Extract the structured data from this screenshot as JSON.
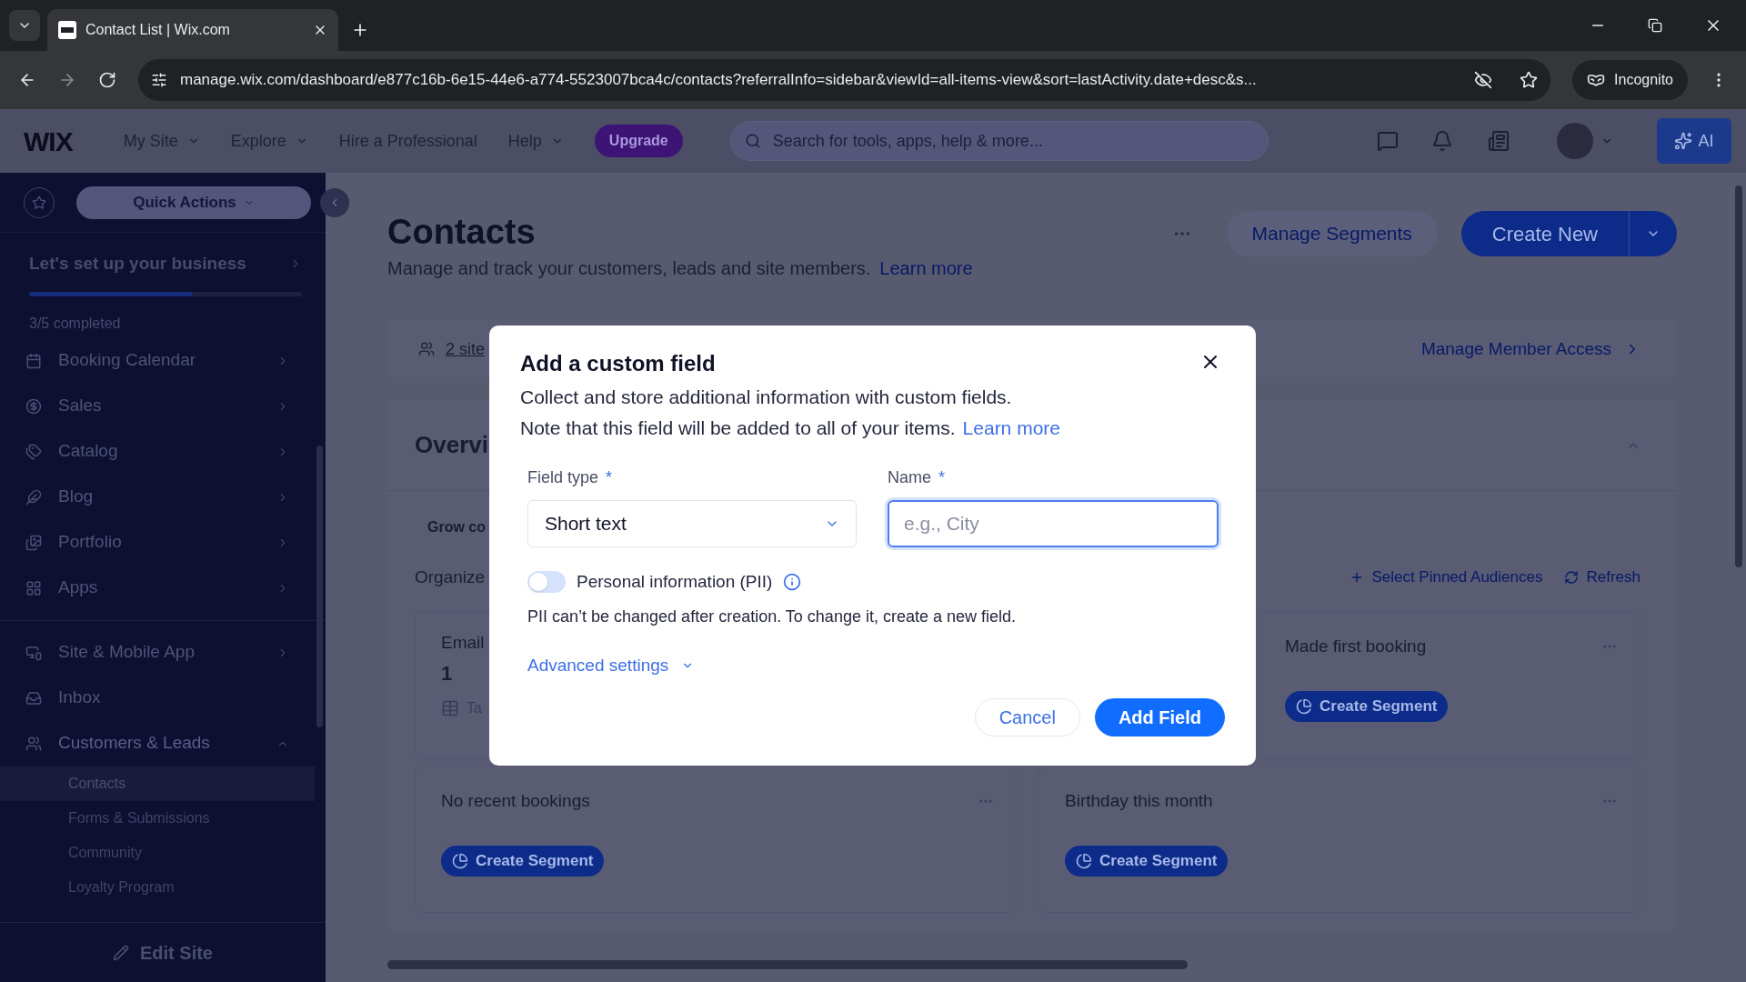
{
  "browser": {
    "tab_title": "Contact List | Wix.com",
    "url": "manage.wix.com/dashboard/e877c16b-6e15-44e6-a774-5523007bca4c/contacts?referralInfo=sidebar&viewId=all-items-view&sort=lastActivity.date+desc&s...",
    "incognito": "Incognito"
  },
  "wix_header": {
    "logo": "WIX",
    "nav": [
      {
        "label": "My Site",
        "kind": "menu"
      },
      {
        "label": "Explore",
        "kind": "menu"
      },
      {
        "label": "Hire a Professional",
        "kind": "link"
      },
      {
        "label": "Help",
        "kind": "menu"
      }
    ],
    "upgrade": "Upgrade",
    "search": {
      "placeholder": "Search for tools, apps, help & more..."
    },
    "ai": "AI"
  },
  "sidebar": {
    "quick_actions": "Quick Actions",
    "setup": {
      "title": "Let's set up your business",
      "level": 0.6,
      "progress": "3/5 completed"
    },
    "sections": [
      {
        "items": [
          {
            "label": "Booking Calendar",
            "kind": "group",
            "expanded": false
          },
          {
            "label": "Sales",
            "kind": "group",
            "expanded": false
          },
          {
            "label": "Catalog",
            "kind": "group",
            "expanded": false
          },
          {
            "label": "Blog",
            "kind": "group",
            "expanded": false
          },
          {
            "label": "Portfolio",
            "kind": "group",
            "expanded": false
          },
          {
            "label": "Apps",
            "kind": "group",
            "expanded": false
          }
        ]
      },
      {
        "items": [
          {
            "label": "Site & Mobile App",
            "kind": "group",
            "expanded": false
          },
          {
            "label": "Inbox",
            "kind": "link",
            "expanded": false
          },
          {
            "label": "Customers & Leads",
            "kind": "group",
            "expanded": true,
            "children": [
              {
                "label": "Contacts",
                "selected": true
              },
              {
                "label": "Forms & Submissions",
                "selected": false
              },
              {
                "label": "Community",
                "selected": false
              },
              {
                "label": "Loyalty Program",
                "selected": false
              }
            ]
          }
        ]
      }
    ],
    "edit_site": "Edit Site"
  },
  "page": {
    "title": "Contacts",
    "subtitle": "Manage and track your customers, leads and site members.",
    "subtitle_link": "Learn more",
    "manage_segments": "Manage Segments",
    "create_new": "Create New",
    "members_bar": {
      "link": "2 site",
      "manage_access": "Manage Member Access"
    },
    "overview": {
      "title": "Overvi",
      "tab": "Grow co",
      "description": "Organize",
      "actions": [
        "Select Pinned Audiences",
        "Refresh"
      ],
      "cards": [
        {
          "kind": "stat",
          "title": "Email",
          "value": "1",
          "footer": "Ta"
        },
        {
          "kind": "segment",
          "title": "Made first booking",
          "button": "Create Segment"
        },
        {
          "kind": "segment",
          "title": "No recent bookings",
          "button": "Create Segment"
        },
        {
          "kind": "segment",
          "title": "Birthday this month",
          "button": "Create Segment"
        }
      ]
    }
  },
  "modal": {
    "title": "Add a custom field",
    "lines": [
      "Collect and store additional information with custom fields.",
      "Note that this field will be added to all of your items."
    ],
    "link": "Learn more",
    "field_type": {
      "label": "Field type",
      "required_mark": "*",
      "value": "Short text"
    },
    "name": {
      "label": "Name",
      "required_mark": "*",
      "placeholder": "e.g., City"
    },
    "pii": {
      "label": "Personal information (PII)",
      "on": false
    },
    "pii_note": "PII can’t be changed after creation. To change it, create a new field.",
    "advanced": "Advanced settings",
    "cancel": "Cancel",
    "submit": "Add Field"
  }
}
